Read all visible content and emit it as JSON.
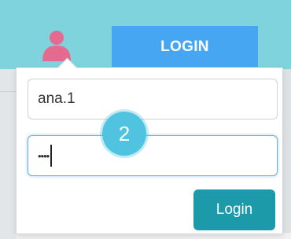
{
  "header": {
    "user_icon": "user-icon",
    "login_tab_label": "LOGIN",
    "bar_color": "#7fd3dc",
    "tab_color": "#47a6f2"
  },
  "login_form": {
    "username_value": "ana.1",
    "password_value": "••••",
    "step_number": "2",
    "submit_label": "Login",
    "submit_color": "#1d9aa9",
    "focus_color": "#66afe9"
  }
}
